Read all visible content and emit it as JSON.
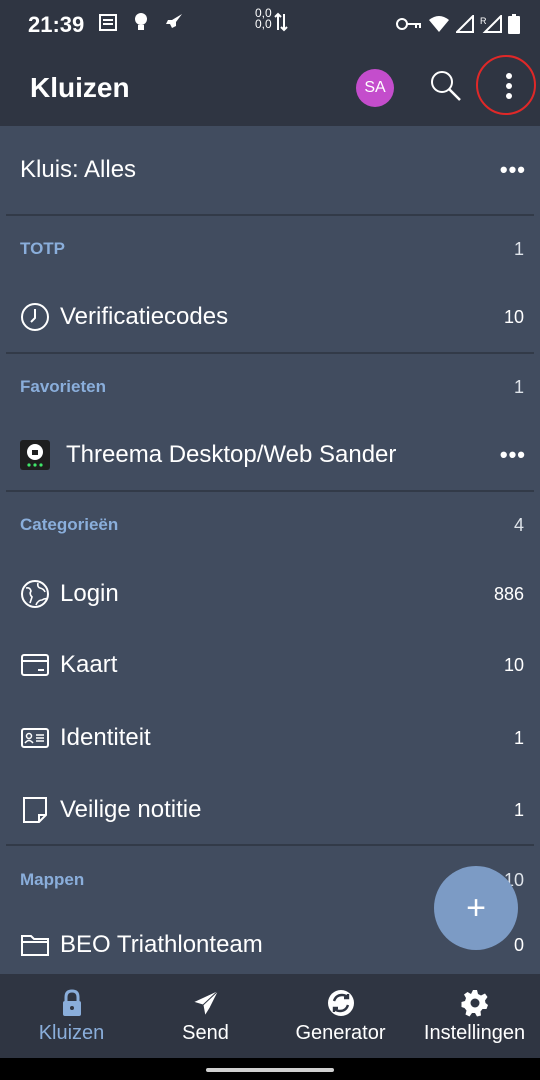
{
  "status": {
    "time": "21:39",
    "net_up": "0,0",
    "net_down": "0,0"
  },
  "appbar": {
    "title": "Kluizen",
    "avatar_initials": "SA",
    "avatar_color": "#c44dcc"
  },
  "vault_filter": {
    "label": "Kluis: Alles",
    "more": "•••"
  },
  "sections": {
    "totp": {
      "title": "TOTP",
      "count": "1"
    },
    "totp_item": {
      "label": "Verificatiecodes",
      "count": "10"
    },
    "favorites": {
      "title": "Favorieten",
      "count": "1"
    },
    "fav_item": {
      "label": "Threema Desktop/Web Sander",
      "more": "•••"
    },
    "categories": {
      "title": "Categorieën",
      "count": "4"
    },
    "cat_login": {
      "label": "Login",
      "count": "886"
    },
    "cat_card": {
      "label": "Kaart",
      "count": "10"
    },
    "cat_identity": {
      "label": "Identiteit",
      "count": "1"
    },
    "cat_note": {
      "label": "Veilige notitie",
      "count": "1"
    },
    "folders": {
      "title": "Mappen",
      "count": "10"
    },
    "folder_beo": {
      "label": "BEO Triathlonteam",
      "count": "0"
    }
  },
  "fab": {
    "symbol": "+"
  },
  "bottom_nav": {
    "vaults": "Kluizen",
    "send": "Send",
    "generator": "Generator",
    "settings": "Instellingen"
  },
  "colors": {
    "background": "#414c5f",
    "bar": "#2f3542",
    "accent": "#8aaedb",
    "fab": "#7c9bc5",
    "highlight_ring": "#e02828"
  }
}
